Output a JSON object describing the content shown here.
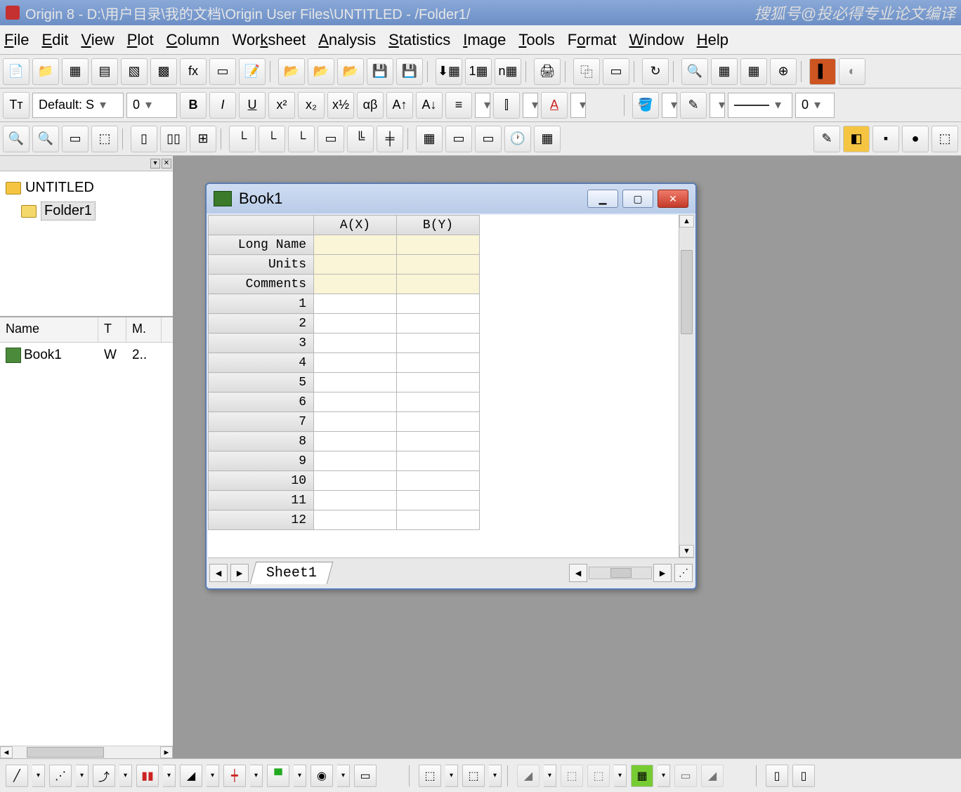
{
  "title": "Origin 8 - D:\\用户目录\\我的文档\\Origin User Files\\UNTITLED - /Folder1/",
  "watermark": "搜狐号@投必得专业论文编译",
  "menubar": [
    "File",
    "Edit",
    "View",
    "Plot",
    "Column",
    "Worksheet",
    "Analysis",
    "Statistics",
    "Image",
    "Tools",
    "Format",
    "Window",
    "Help"
  ],
  "format_bar": {
    "font": "Default: S",
    "size": "0",
    "line_width": "0"
  },
  "project_tree": {
    "root": "UNTITLED",
    "folder": "Folder1"
  },
  "object_list": {
    "headers": [
      "Name",
      "T",
      "M."
    ],
    "rows": [
      {
        "name": "Book1",
        "t": "W",
        "m": "2.."
      }
    ]
  },
  "workbook": {
    "title": "Book1",
    "columns": [
      "A(X)",
      "B(Y)"
    ],
    "meta_rows": [
      "Long Name",
      "Units",
      "Comments"
    ],
    "data_rows": [
      "1",
      "2",
      "3",
      "4",
      "5",
      "6",
      "7",
      "8",
      "9",
      "10",
      "11",
      "12"
    ],
    "sheet_tab": "Sheet1"
  }
}
